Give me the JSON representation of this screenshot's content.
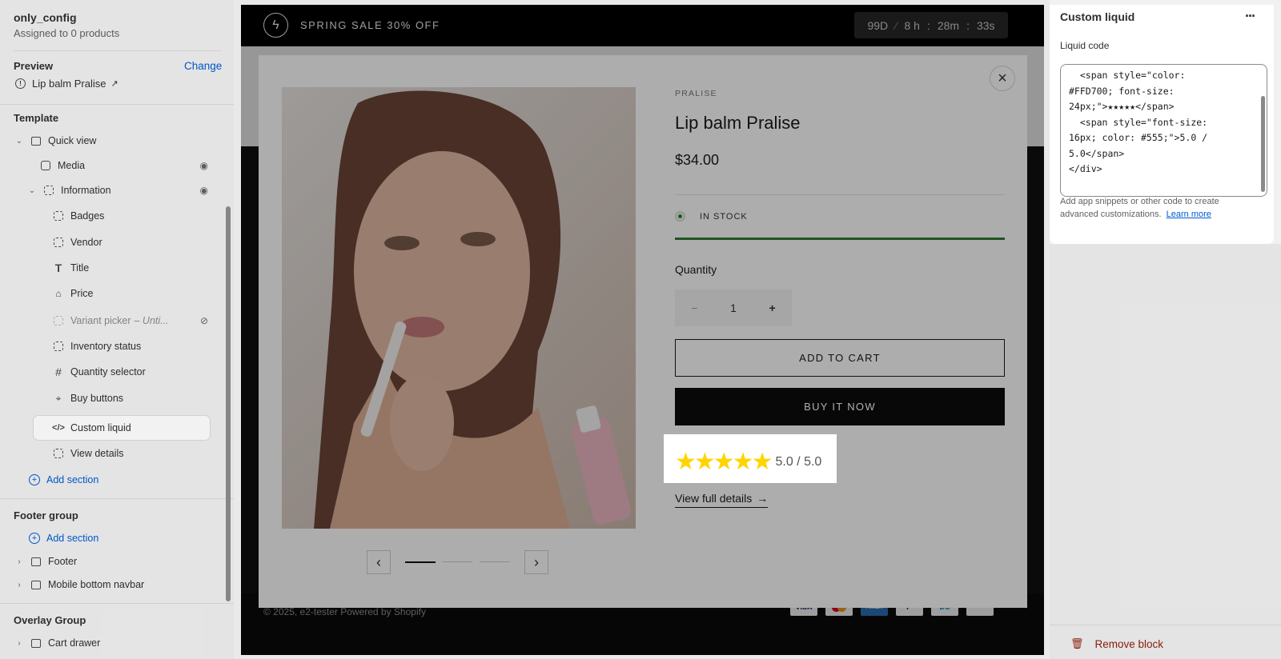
{
  "sidebar": {
    "config_name": "only_config",
    "assigned": "Assigned to 0 products",
    "preview_label": "Preview",
    "change_label": "Change",
    "preview_product": "Lip balm Pralise",
    "template_label": "Template",
    "quick_view": "Quick view",
    "media": "Media",
    "information": "Information",
    "blocks": {
      "badges": "Badges",
      "vendor": "Vendor",
      "title": "Title",
      "price": "Price",
      "variant_picker": "Variant picker",
      "variant_suffix": "– Unti...",
      "inventory": "Inventory status",
      "quantity": "Quantity selector",
      "buy_buttons": "Buy buttons",
      "custom_liquid": "Custom liquid",
      "view_details": "View details"
    },
    "add_section": "Add section",
    "footer_group": "Footer group",
    "add_section_2": "Add section",
    "footer": "Footer",
    "mobile_navbar": "Mobile bottom navbar",
    "overlay_group": "Overlay Group",
    "cart_drawer": "Cart drawer"
  },
  "announcement": {
    "text": "SPRING SALE 30% OFF",
    "days": "99D",
    "sep": "⁄",
    "hours": "8 h",
    "minutes": "28m",
    "seconds": "33s",
    "colon": ":"
  },
  "modal": {
    "vendor": "PRALISE",
    "title": "Lip balm Pralise",
    "price": "$34.00",
    "stock": "IN STOCK",
    "quantity_label": "Quantity",
    "quantity_value": "1",
    "minus": "−",
    "plus": "+",
    "add_to_cart": "ADD TO CART",
    "buy_now": "BUY IT NOW",
    "stars": "★★★★★",
    "rating": "5.0 / 5.0",
    "view_full": "View full details",
    "arrow": "→",
    "close": "×",
    "prev": "‹",
    "next": "›"
  },
  "footer": {
    "copyright": "© 2025, e2-tester Powered by Shopify",
    "payments": [
      "VISA",
      "MC",
      "AMEX",
      "P",
      "DC",
      "DISCOVER"
    ]
  },
  "right_panel": {
    "title": "Custom liquid",
    "more": "···",
    "code_label": "Liquid code",
    "code": "  <span style=\"color:\n#FFD700; font-size:\n24px;\">★★★★★</span>\n  <span style=\"font-size:\n16px; color: #555;\">5.0 /\n5.0</span>\n</div>",
    "help": "Add app snippets or other code to create advanced customizations.",
    "learn_more": "Learn more",
    "remove": "Remove block"
  },
  "colors": {
    "accent_blue": "#005bd3",
    "star_yellow": "#ffd400",
    "stock_green": "#2e7d32",
    "remove_red": "#8e1f0b"
  }
}
